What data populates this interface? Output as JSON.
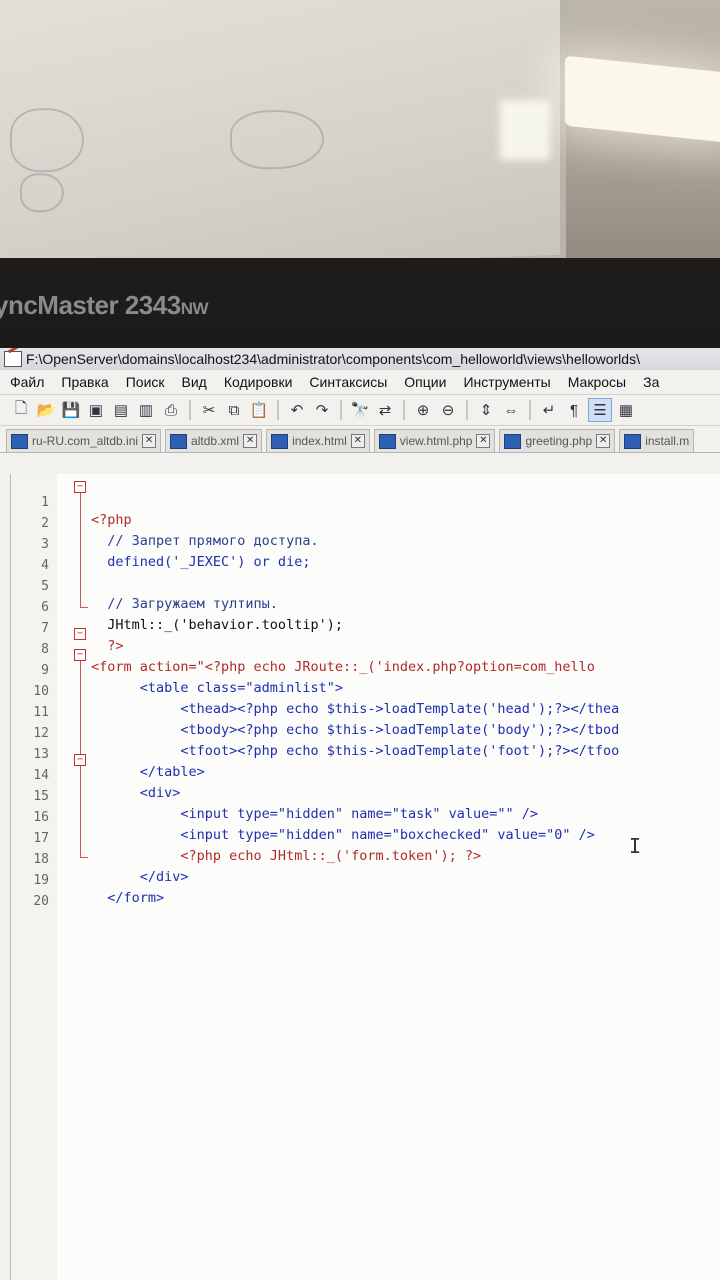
{
  "monitor": {
    "brand": "yncMaster 2343",
    "brand_suffix": "NW"
  },
  "window": {
    "title": "F:\\OpenServer\\domains\\localhost234\\administrator\\components\\com_helloworld\\views\\helloworlds\\"
  },
  "menu": [
    "Файл",
    "Правка",
    "Поиск",
    "Вид",
    "Кодировки",
    "Синтаксисы",
    "Опции",
    "Инструменты",
    "Макросы",
    "За"
  ],
  "toolbar_icons": [
    "new-file-icon",
    "open-icon",
    "save-icon",
    "save-all-icon",
    "close-icon",
    "close-all-icon",
    "print-icon",
    "cut-icon",
    "copy-icon",
    "paste-icon",
    "undo-icon",
    "redo-icon",
    "find-icon",
    "replace-icon",
    "zoom-in-icon",
    "zoom-out-icon",
    "sync-v-icon",
    "sync-h-icon",
    "wrap-icon",
    "show-all-chars-icon",
    "indent-guide-icon",
    "user-lang-icon"
  ],
  "tabs": [
    {
      "label": "ru-RU.com_altdb.ini"
    },
    {
      "label": "altdb.xml"
    },
    {
      "label": "index.html"
    },
    {
      "label": "view.html.php"
    },
    {
      "label": "greeting.php"
    },
    {
      "label": "install.m"
    }
  ],
  "code_lines": [
    "<?php",
    "  // Запрет прямого доступа.",
    "  defined('_JEXEC') or die;",
    "",
    "  // Загружаем тултипы.",
    "  JHtml::_('behavior.tooltip');",
    "  ?>",
    "<form action=\"<?php echo JRoute::_('index.php?option=com_hello",
    "      <table class=\"adminlist\">",
    "           <thead><?php echo $this->loadTemplate('head');?></thea",
    "           <tbody><?php echo $this->loadTemplate('body');?></tbod",
    "           <tfoot><?php echo $this->loadTemplate('foot');?></tfoo",
    "      </table>",
    "      <div>",
    "           <input type=\"hidden\" name=\"task\" value=\"\" />",
    "           <input type=\"hidden\" name=\"boxchecked\" value=\"0\" />",
    "           <?php echo JHtml::_('form.token'); ?>",
    "      </div>",
    "  </form>",
    ""
  ],
  "line_numbers": [
    "1",
    "2",
    "3",
    "4",
    "5",
    "6",
    "7",
    "8",
    "9",
    "10",
    "11",
    "12",
    "13",
    "14",
    "15",
    "16",
    "17",
    "18",
    "19",
    "20"
  ],
  "colors": {
    "keyword": "#1e2fb0",
    "tag": "#b12a2a",
    "comment": "#2a3f8f",
    "background": "#fcfcfa"
  }
}
